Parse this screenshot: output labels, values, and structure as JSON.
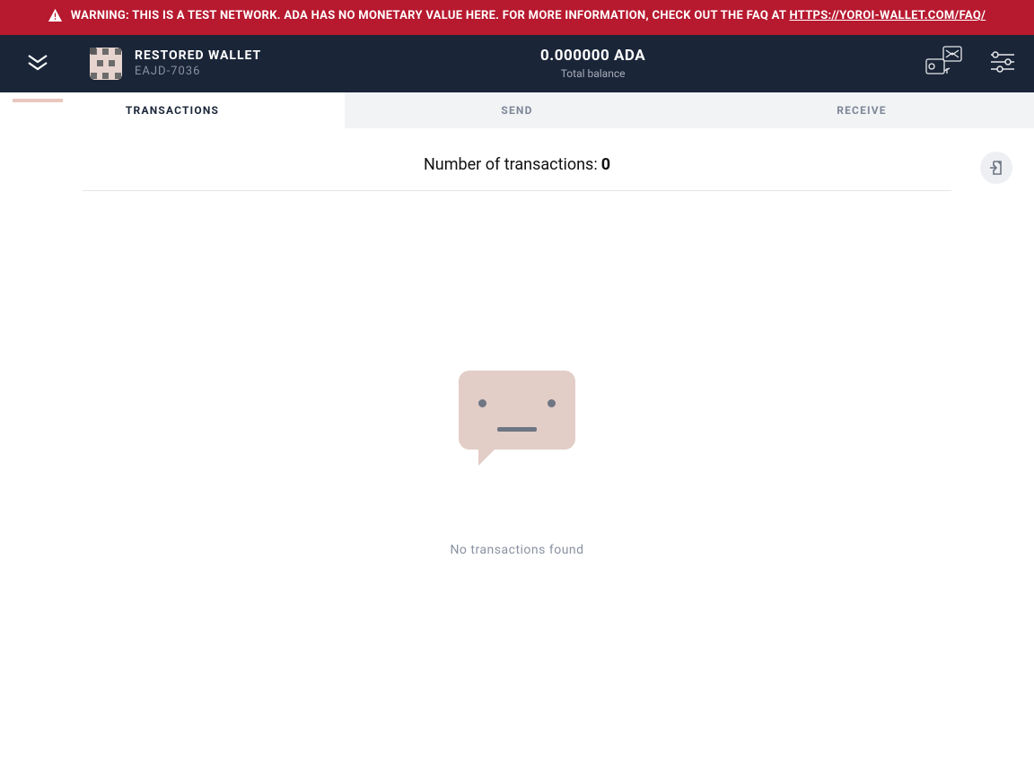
{
  "warning": {
    "text": "WARNING: THIS IS A TEST NETWORK. ADA HAS NO MONETARY VALUE HERE. FOR MORE INFORMATION, CHECK OUT THE FAQ AT ",
    "link_text": "HTTPS://YOROI-WALLET.COM/FAQ/"
  },
  "header": {
    "wallet_name": "RESTORED WALLET",
    "wallet_id": "EAJD-7036",
    "balance": "0.000000 ADA",
    "balance_label": "Total balance"
  },
  "tabs": {
    "transactions": "TRANSACTIONS",
    "send": "SEND",
    "receive": "RECEIVE",
    "active": "transactions"
  },
  "transactions": {
    "count_label": "Number of transactions: ",
    "count": "0",
    "empty_message": "No transactions found"
  }
}
